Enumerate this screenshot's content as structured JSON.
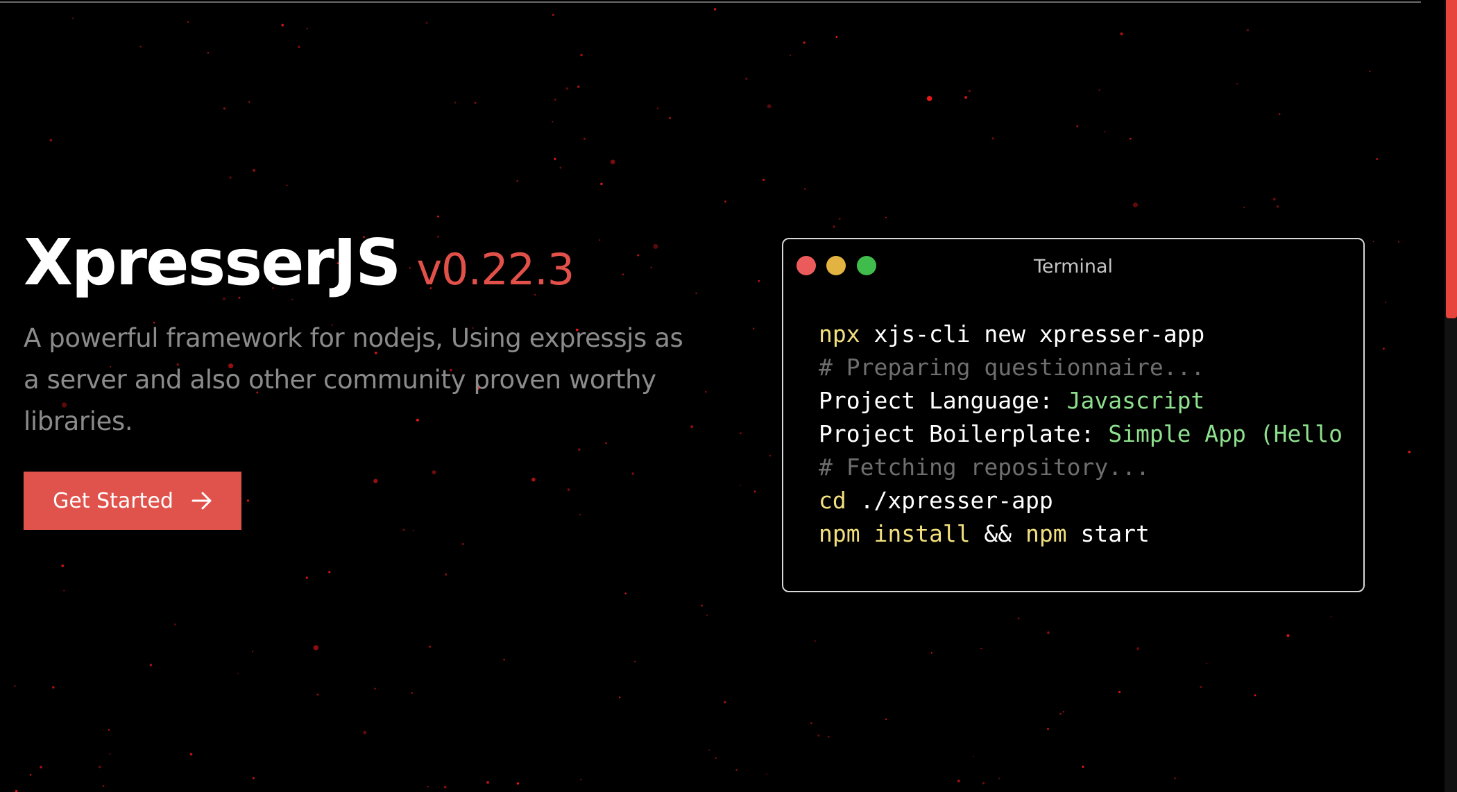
{
  "hero": {
    "title": "XpresserJS",
    "version": "v0.22.3",
    "description": "A powerful framework for nodejs, Using expressjs as a server and also other community proven worthy libraries.",
    "cta_label": "Get Started",
    "cta_icon": "arrow-right-icon"
  },
  "terminal": {
    "title": "Terminal",
    "window_buttons": [
      "close",
      "minimize",
      "maximize"
    ],
    "lines": [
      {
        "parts": [
          {
            "t": "npx",
            "k": "cmd"
          },
          {
            "t": " xjs-cli new xpresser-app",
            "k": "txt"
          }
        ]
      },
      {
        "parts": [
          {
            "t": "# Preparing questionnaire...",
            "k": "cmt"
          }
        ]
      },
      {
        "parts": [
          {
            "t": "Project Language: ",
            "k": "txt"
          },
          {
            "t": "Javascript",
            "k": "val"
          }
        ]
      },
      {
        "parts": [
          {
            "t": "Project Boilerplate: ",
            "k": "txt"
          },
          {
            "t": "Simple App (Hello W",
            "k": "val"
          }
        ]
      },
      {
        "parts": [
          {
            "t": "# Fetching repository...",
            "k": "cmt"
          }
        ]
      },
      {
        "parts": [
          {
            "t": "cd",
            "k": "cmd"
          },
          {
            "t": " ./xpresser-app",
            "k": "txt"
          }
        ]
      },
      {
        "parts": [
          {
            "t": "npm",
            "k": "cmd"
          },
          {
            "t": " ",
            "k": "txt"
          },
          {
            "t": "install",
            "k": "cmd"
          },
          {
            "t": " && ",
            "k": "txt"
          },
          {
            "t": "npm",
            "k": "cmd"
          },
          {
            "t": " start",
            "k": "txt"
          }
        ]
      }
    ]
  },
  "colors": {
    "background": "#000000",
    "accent": "#e0534c",
    "command": "#f2e07f",
    "comment": "#6e6e6e",
    "value": "#8ee08e",
    "particle": "#ff1a1a"
  }
}
